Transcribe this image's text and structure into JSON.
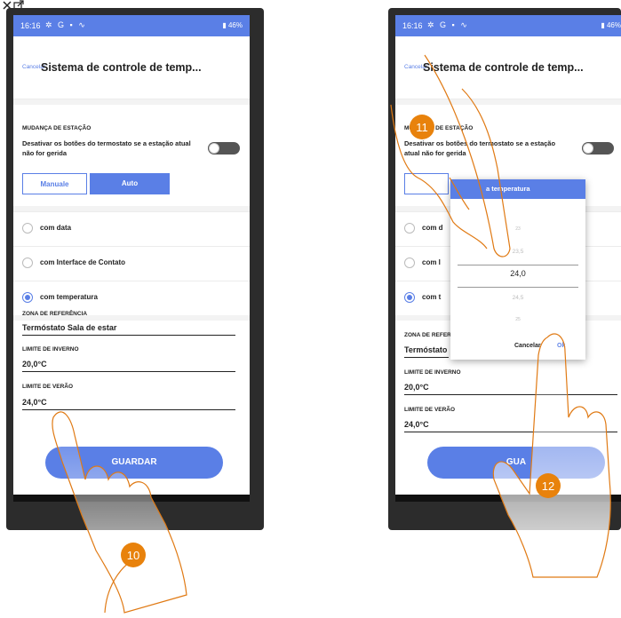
{
  "status_bar": {
    "time": "16:16",
    "left_icons": [
      "settings-icon",
      "google-icon",
      "message-icon",
      "signal-icon"
    ],
    "battery": "46%"
  },
  "header": {
    "cancel_label": "Cancelar",
    "title_left": "Sistema de controle de temp...",
    "title_right": "Sistema de controle de temp..."
  },
  "season_change": {
    "section_label": "MUDANÇA DE ESTAÇÃO",
    "description": "Desativar os botões do termostato se a estação atual não for gerida",
    "toggle_on": false,
    "mode_options": [
      "Manuale",
      "Auto"
    ],
    "selected_mode": "Auto"
  },
  "options": [
    {
      "label": "com data",
      "selected": false
    },
    {
      "label": "com Interface de Contato",
      "selected": false
    },
    {
      "label": "com temperatura",
      "selected": true
    }
  ],
  "right_options_truncated": [
    "com d",
    "com I",
    "com t"
  ],
  "reference_zone": {
    "label": "ZONA DE REFERÊNCIA",
    "value": "Termóstato Sala de estar",
    "value_truncated": "Termóstato"
  },
  "winter_limit": {
    "label": "LIMITE DE INVERNO",
    "value": "20,0°C"
  },
  "summer_limit": {
    "label": "LIMITE DE VERÃO",
    "value": "24,0°C"
  },
  "save_label": "GUARDAR",
  "save_label_partial": "GUA",
  "dialog": {
    "title": "a temperatura",
    "values": [
      "23",
      "23,5",
      "24,0",
      "24,5",
      "25"
    ],
    "selected": "24,0",
    "cancel_label": "Cancelar",
    "ok_label": "Ok"
  },
  "steps": [
    "10",
    "11",
    "12"
  ],
  "colors": {
    "accent": "#5a7fe6",
    "hand_outline": "#e07a14",
    "badge": "#e8820c",
    "phone_frame": "#2c2c2c"
  }
}
